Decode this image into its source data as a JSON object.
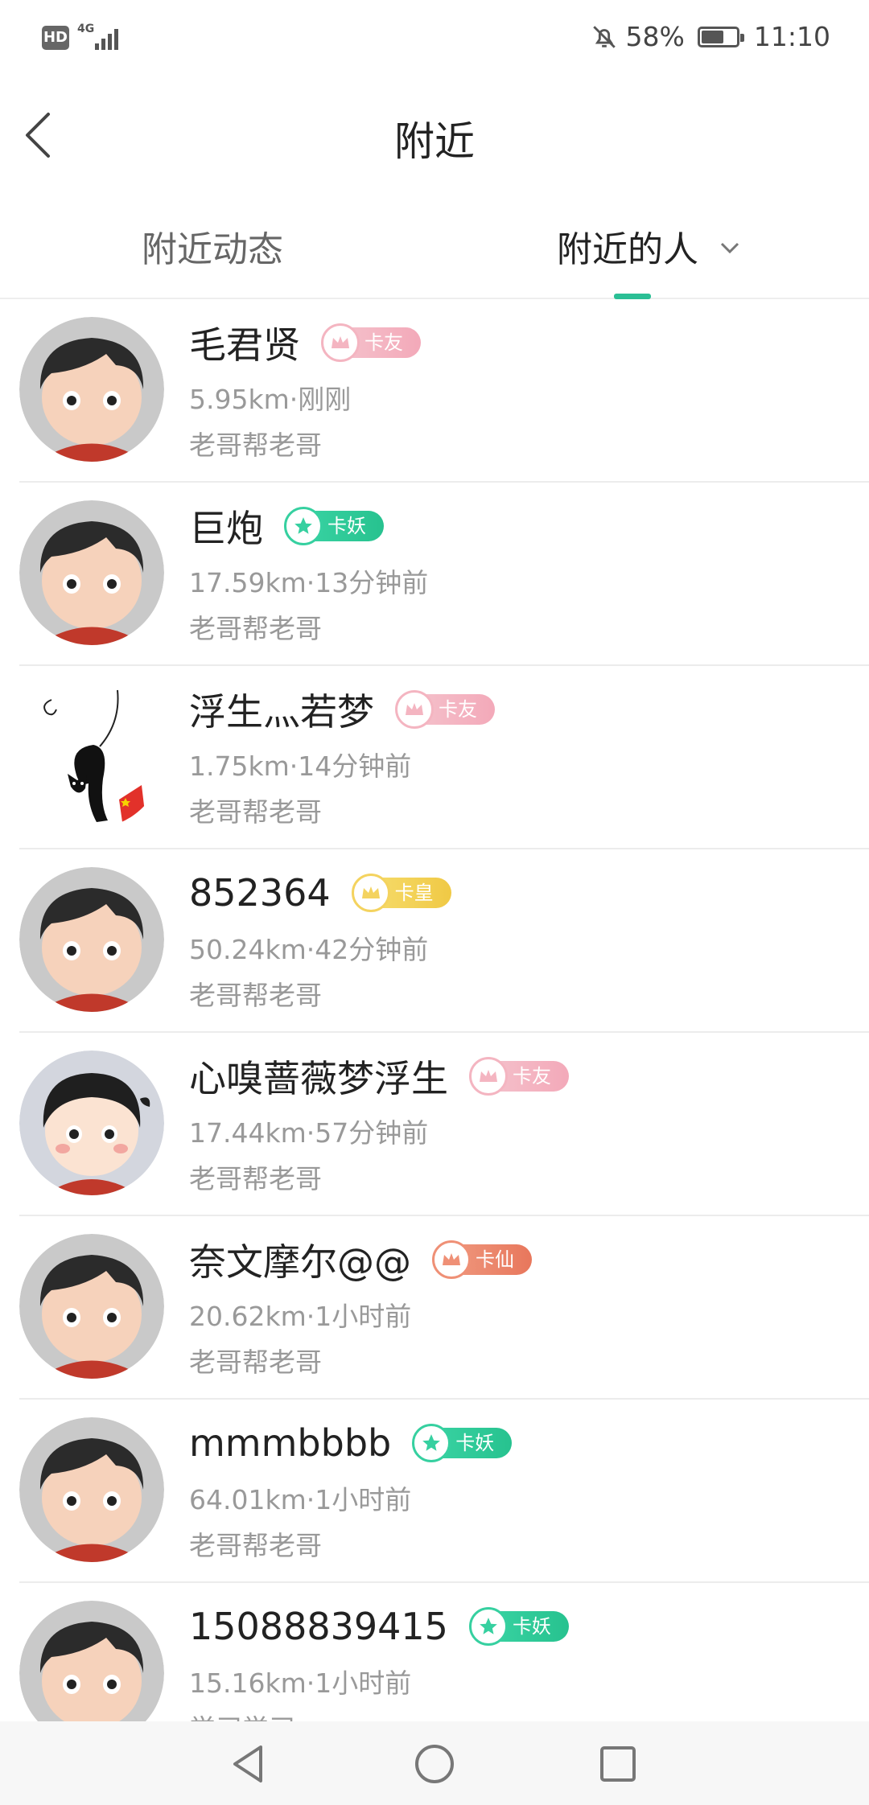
{
  "statusbar": {
    "hd": "HD",
    "network": "4G",
    "battery": "58%",
    "time": "11:10"
  },
  "header": {
    "title": "附近"
  },
  "tabs": {
    "feed": "附近动态",
    "people": "附近的人"
  },
  "users": [
    {
      "name": "毛君贤",
      "badge": "卡友",
      "meta": "5.95km·刚刚",
      "group": "老哥帮老哥"
    },
    {
      "name": "巨炮",
      "badge": "卡妖",
      "meta": "17.59km·13分钟前",
      "group": "老哥帮老哥"
    },
    {
      "name": "浮生灬若梦",
      "badge": "卡友",
      "meta": "1.75km·14分钟前",
      "group": "老哥帮老哥"
    },
    {
      "name": "852364",
      "badge": "卡皇",
      "meta": "50.24km·42分钟前",
      "group": "老哥帮老哥"
    },
    {
      "name": "心嗅蔷薇梦浮生",
      "badge": "卡友",
      "meta": "17.44km·57分钟前",
      "group": "老哥帮老哥"
    },
    {
      "name": "奈文摩尔@@",
      "badge": "卡仙",
      "meta": "20.62km·1小时前",
      "group": "老哥帮老哥"
    },
    {
      "name": "mmmbbbb",
      "badge": "卡妖",
      "meta": "64.01km·1小时前",
      "group": "老哥帮老哥"
    },
    {
      "name": "15088839415",
      "badge": "卡妖",
      "meta": "15.16km·1小时前",
      "group": "学习学习"
    }
  ]
}
